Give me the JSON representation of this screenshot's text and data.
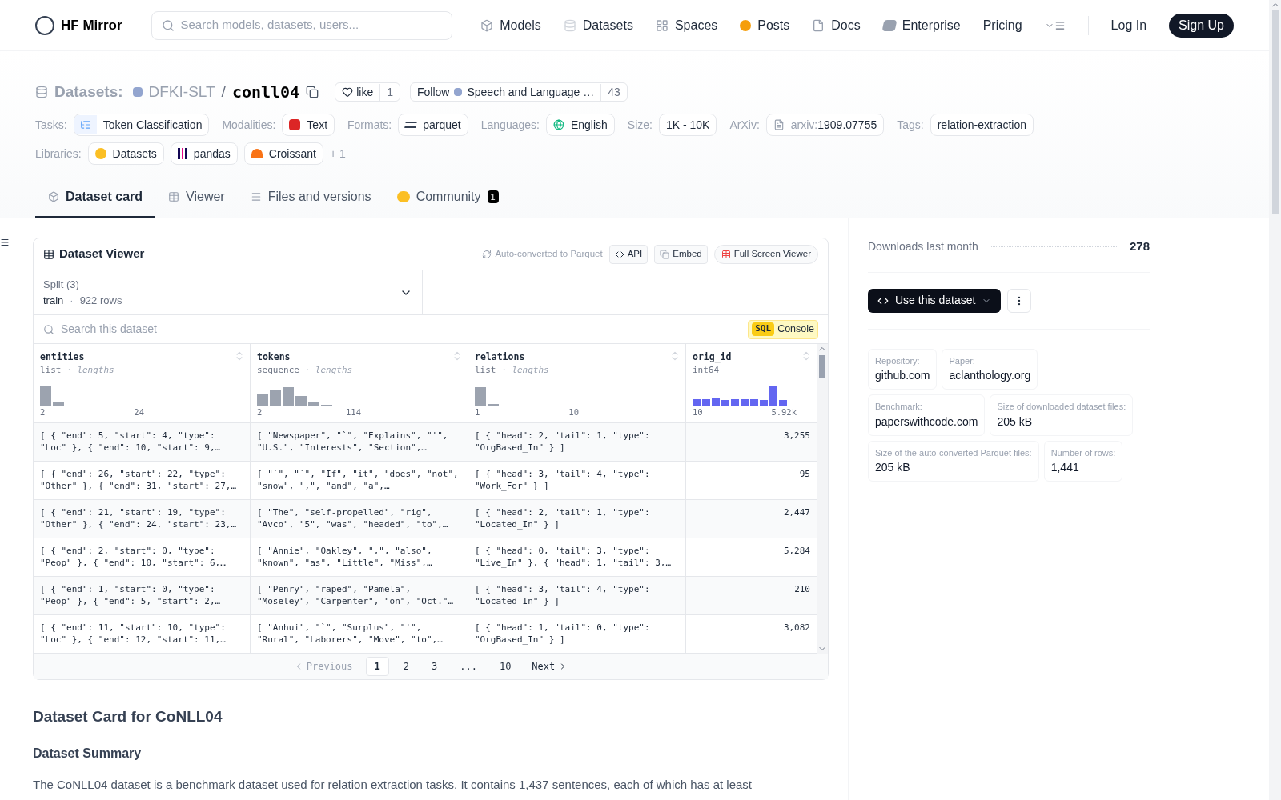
{
  "header": {
    "brand": "HF Mirror",
    "search": {
      "placeholder": "Search models, datasets, users..."
    },
    "nav": [
      {
        "label": "Models",
        "kind": "models"
      },
      {
        "label": "Datasets",
        "kind": "datasets"
      },
      {
        "label": "Spaces",
        "kind": "spaces"
      },
      {
        "label": "Posts",
        "kind": "posts"
      },
      {
        "label": "Docs",
        "kind": "docs"
      },
      {
        "label": "Enterprise",
        "kind": "enterprise"
      },
      {
        "label": "Pricing",
        "kind": "plain"
      }
    ],
    "login": "Log In",
    "signup": "Sign Up"
  },
  "title": {
    "section": "Datasets:",
    "org": "DFKI-SLT",
    "sep": "/",
    "name": "conll04",
    "like": "like",
    "likes": "1",
    "follow": "Follow",
    "follow_org": "Speech and Language …",
    "followers": "43"
  },
  "meta_rows": [
    [
      {
        "label": "Tasks:",
        "tags": [
          {
            "text": "Token Classification",
            "kind": "task"
          }
        ]
      },
      {
        "label": "Modalities:",
        "tags": [
          {
            "text": "Text",
            "kind": "text"
          }
        ]
      },
      {
        "label": "Formats:",
        "tags": [
          {
            "text": "parquet",
            "kind": "parquet"
          }
        ]
      },
      {
        "label": "Languages:",
        "tags": [
          {
            "text": "English",
            "kind": "globe"
          }
        ]
      },
      {
        "label": "Size:",
        "tags": [
          {
            "text": "1K - 10K",
            "kind": "plain"
          }
        ]
      },
      {
        "label": "ArXiv:",
        "tags": [
          {
            "text": "1909.07755",
            "prefix": "arxiv:",
            "kind": "paper"
          }
        ]
      },
      {
        "label": "Tags:",
        "tags": [
          {
            "text": "relation-extraction",
            "kind": "plain"
          }
        ]
      }
    ],
    [
      {
        "label": "Libraries:",
        "tags": [
          {
            "text": "Datasets",
            "kind": "hug"
          },
          {
            "text": "pandas",
            "kind": "pandas"
          },
          {
            "text": "Croissant",
            "kind": "croissant"
          }
        ],
        "more": "+ 1"
      }
    ]
  ],
  "tabs": [
    {
      "label": "Dataset card",
      "kind": "card",
      "selected": true
    },
    {
      "label": "Viewer",
      "kind": "viewer",
      "selected": false
    },
    {
      "label": "Files and versions",
      "kind": "files",
      "selected": false
    },
    {
      "label": "Community",
      "kind": "community",
      "selected": false,
      "badge": "1"
    }
  ],
  "viewer": {
    "title": "Dataset Viewer",
    "auto_link": "Auto-converted",
    "auto_rest": "to Parquet",
    "api": "API",
    "embed": "Embed",
    "fullscreen": "Full Screen Viewer",
    "split": {
      "label": "Split (3)",
      "value": "train",
      "dot": "·",
      "rows": "922 rows"
    },
    "search": {
      "placeholder": "Search this dataset"
    },
    "sql": "SQL",
    "console": "Console",
    "stat_sep": "·",
    "columns": [
      {
        "name": "entities",
        "type": "list",
        "stat": "lengths",
        "min": "2",
        "max": "24",
        "kind": "grey"
      },
      {
        "name": "tokens",
        "type": "sequence",
        "stat": "lengths",
        "min": "2",
        "max": "114",
        "kind": "grey"
      },
      {
        "name": "relations",
        "type": "list",
        "stat": "lengths",
        "min": "1",
        "max": "10",
        "kind": "grey"
      },
      {
        "name": "orig_id",
        "type": "int64",
        "min": "10",
        "max": "5.92k",
        "kind": "blue"
      }
    ],
    "rows": [
      [
        "[ { \"end\": 5, \"start\": 4, \"type\": \"Loc\" }, { \"end\": 10, \"start\": 9,…",
        "[ \"Newspaper\", \"`\", \"Explains\", \"'\", \"U.S.\", \"Interests\", \"Section\",…",
        "[ { \"head\": 2, \"tail\": 1, \"type\": \"OrgBased_In\" } ]",
        "3,255"
      ],
      [
        "[ { \"end\": 26, \"start\": 22, \"type\": \"Other\" }, { \"end\": 31, \"start\": 27,…",
        "[ \"`\", \"`\", \"If\", \"it\", \"does\", \"not\", \"snow\", \",\", \"and\", \"a\",…",
        "[ { \"head\": 3, \"tail\": 4, \"type\": \"Work_For\" } ]",
        "95"
      ],
      [
        "[ { \"end\": 21, \"start\": 19, \"type\": \"Other\" }, { \"end\": 24, \"start\": 23,…",
        "[ \"The\", \"self-propelled\", \"rig\", \"Avco\", \"5\", \"was\", \"headed\", \"to\",…",
        "[ { \"head\": 2, \"tail\": 1, \"type\": \"Located_In\" } ]",
        "2,447"
      ],
      [
        "[ { \"end\": 2, \"start\": 0, \"type\": \"Peop\" }, { \"end\": 10, \"start\": 6,…",
        "[ \"Annie\", \"Oakley\", \",\", \"also\", \"known\", \"as\", \"Little\", \"Miss\",…",
        "[ { \"head\": 0, \"tail\": 3, \"type\": \"Live_In\" }, { \"head\": 1, \"tail\": 3,…",
        "5,284"
      ],
      [
        "[ { \"end\": 1, \"start\": 0, \"type\": \"Peop\" }, { \"end\": 5, \"start\": 2,…",
        "[ \"Penry\", \"raped\", \"Pamela\", \"Moseley\", \"Carpenter\", \"on\", \"Oct.\"…",
        "[ { \"head\": 3, \"tail\": 4, \"type\": \"Located_In\" } ]",
        "210"
      ],
      [
        "[ { \"end\": 11, \"start\": 10, \"type\": \"Loc\" }, { \"end\": 12, \"start\": 11,…",
        "[ \"Anhui\", \"`\", \"Surplus\", \"'\", \"Rural\", \"Laborers\", \"Move\", \"to\",…",
        "[ { \"head\": 1, \"tail\": 0, \"type\": \"OrgBased_In\" } ]",
        "3,082"
      ]
    ],
    "pagination": {
      "previous": "Previous",
      "next": "Next",
      "pages": [
        {
          "label": "1",
          "selected": true
        },
        {
          "label": "2",
          "selected": false
        },
        {
          "label": "3",
          "selected": false
        },
        {
          "label": "...",
          "selected": false
        },
        {
          "label": "10",
          "selected": false
        }
      ]
    }
  },
  "card": {
    "heading": "Dataset Card for CoNLL04",
    "subheading": "Dataset Summary",
    "text": "The CoNLL04 dataset is a benchmark dataset used for relation extraction tasks. It contains 1,437 sentences, each of which has at least"
  },
  "sidebar": {
    "downloads_label": "Downloads last month",
    "downloads": "278",
    "use": "Use this dataset",
    "facts": [
      [
        {
          "label": "Repository:",
          "value": "github.com"
        },
        {
          "label": "Paper:",
          "value": "aclanthology.org"
        }
      ],
      [
        {
          "label": "Benchmark:",
          "value": "paperswithcode.com"
        },
        {
          "label": "Size of downloaded dataset files:",
          "value": "205 kB"
        }
      ],
      [
        {
          "label": "Size of the auto-converted Parquet files:",
          "value": "205 kB"
        },
        {
          "label": "Number of rows:",
          "value": "1,441"
        }
      ]
    ]
  }
}
